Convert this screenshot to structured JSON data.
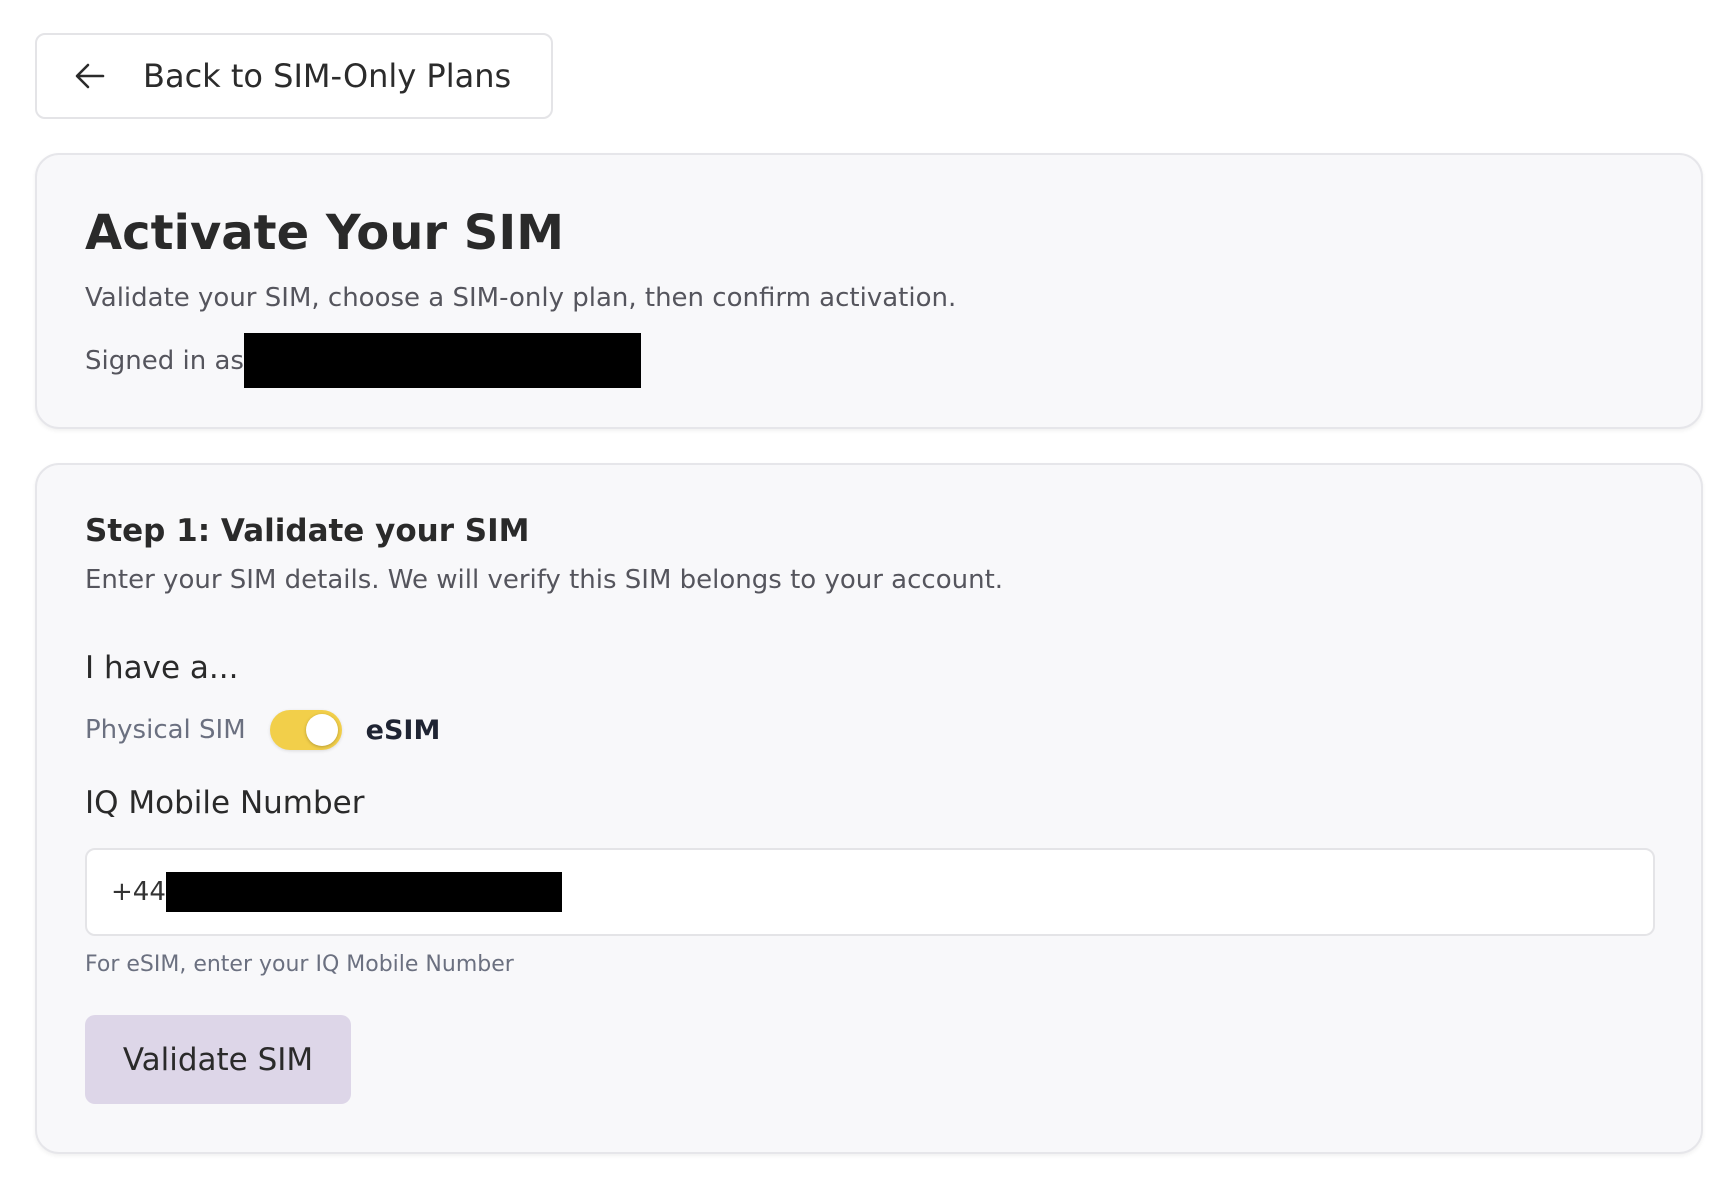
{
  "nav": {
    "back_label": "Back to SIM-Only Plans",
    "back_icon": "arrow-left-icon"
  },
  "header": {
    "title": "Activate Your SIM",
    "subtitle": "Validate your SIM, choose a SIM-only plan, then confirm activation.",
    "signed_in_label": "Signed in as"
  },
  "step1": {
    "title": "Step 1: Validate your SIM",
    "description": "Enter your SIM details. We will verify this SIM belongs to your account.",
    "sim_type_label": "I have a...",
    "toggle": {
      "left_option": "Physical SIM",
      "right_option": "eSIM",
      "selected": "eSIM",
      "accent_color": "#f2cf4a"
    },
    "number_label": "IQ Mobile Number",
    "number_value_prefix": "+44",
    "helper_text": "For eSIM, enter your IQ Mobile Number",
    "validate_label": "Validate SIM",
    "validate_color": "#ddd6e8"
  }
}
